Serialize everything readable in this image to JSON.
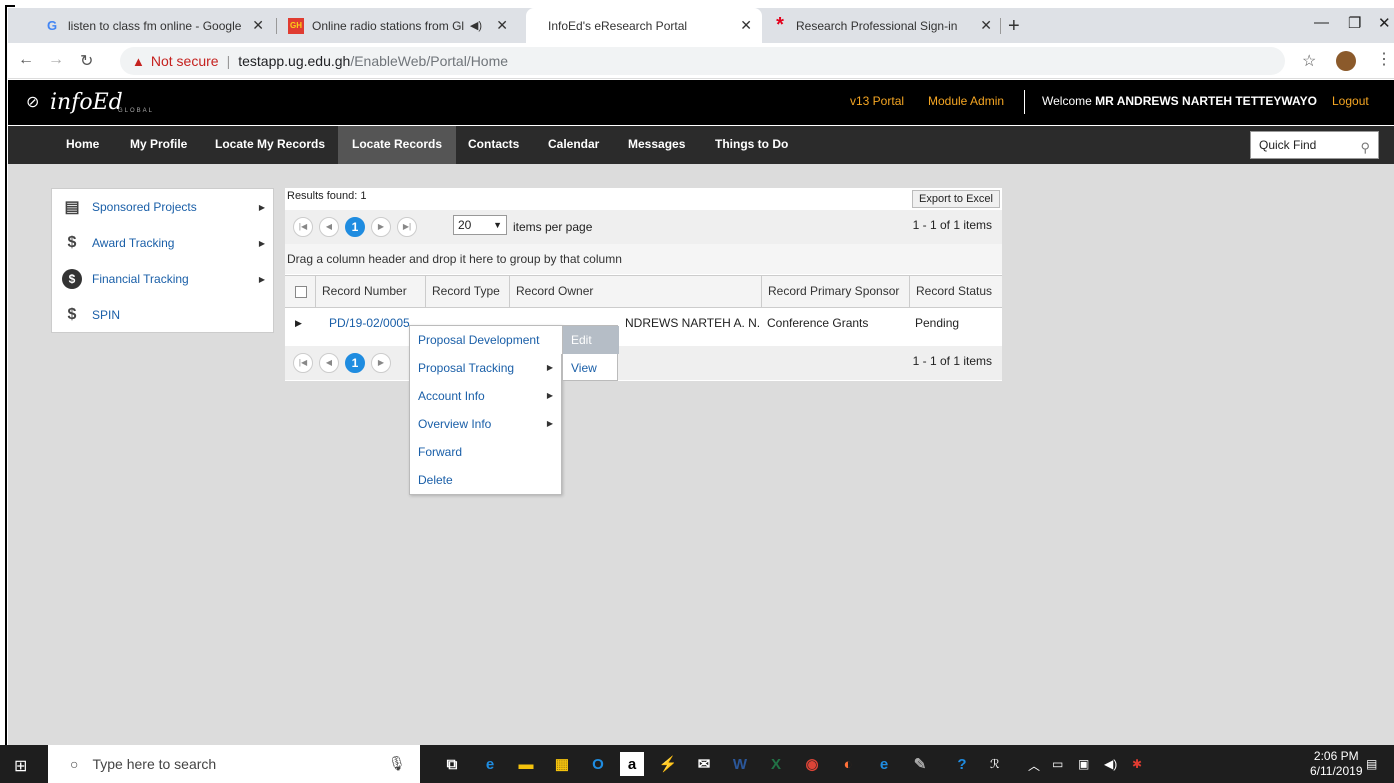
{
  "browser": {
    "tabs": [
      {
        "title": "listen to class fm online - Google",
        "favicon": "G"
      },
      {
        "title": "Online radio stations from Gl",
        "favicon": "GH"
      },
      {
        "title": "InfoEd's eResearch Portal",
        "favicon": ""
      },
      {
        "title": "Research Professional Sign-in",
        "favicon": "*"
      }
    ],
    "new_tab": "+",
    "not_secure": "Not secure",
    "url_host": "testapp.ug.edu.gh",
    "url_path": "/EnableWeb/Portal/Home"
  },
  "header": {
    "logo": "infoEd",
    "logo_sub": "GLOBAL",
    "links": [
      "v13 Portal",
      "Module Admin"
    ],
    "welcome_prefix": "Welcome",
    "welcome_name": "MR ANDREWS NARTEH TETTEYWAYO",
    "logout": "Logout"
  },
  "nav": {
    "items": [
      "Home",
      "My Profile",
      "Locate My Records",
      "Locate Records",
      "Contacts",
      "Calendar",
      "Messages",
      "Things to Do"
    ],
    "active": "Locate Records",
    "quick_find": "Quick Find"
  },
  "sidemenu": {
    "items": [
      {
        "label": "Sponsored Projects",
        "icon": "document-icon"
      },
      {
        "label": "Award Tracking",
        "icon": "dollar-icon"
      },
      {
        "label": "Financial Tracking",
        "icon": "dollar-circle-icon"
      },
      {
        "label": "SPIN",
        "icon": "dollar-icon"
      }
    ]
  },
  "grid": {
    "results": "Results found: 1",
    "export": "Export to Excel",
    "current_page": "1",
    "page_size": "20",
    "items_per_page": "items per page",
    "page_info": "1 - 1 of 1 items",
    "group_hint": "Drag a column header and drop it here to group by that column",
    "columns": [
      "Record Number",
      "Record Type",
      "Record Owner",
      "Record Primary Sponsor",
      "Record Status"
    ],
    "row": {
      "record_number": "PD/19-02/0005",
      "record_owner": "NDREWS NARTEH A. N.",
      "sponsor": "Conference Grants",
      "status": "Pending"
    }
  },
  "context_menu": {
    "items": [
      "Proposal Development",
      "Proposal Tracking",
      "Account Info",
      "Overview Info",
      "Forward",
      "Delete"
    ],
    "submenu": [
      "Edit",
      "View"
    ]
  },
  "taskbar": {
    "search_placeholder": "Type here to search",
    "time": "2:06 PM",
    "date": "6/11/2019"
  }
}
